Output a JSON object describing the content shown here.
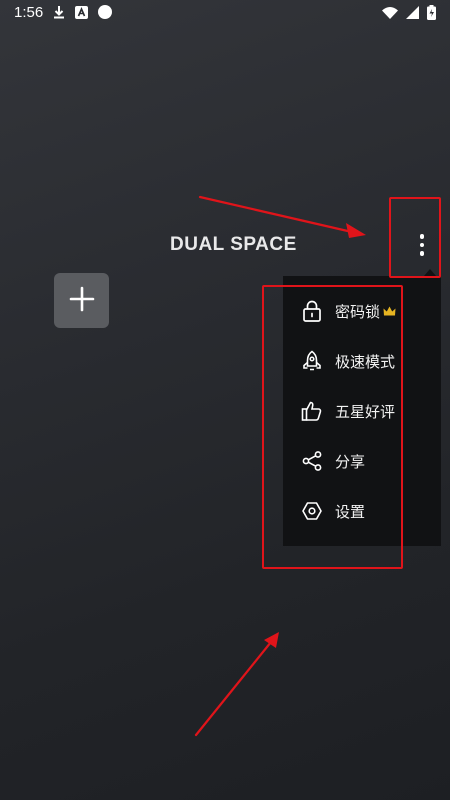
{
  "status_bar": {
    "time": "1:56",
    "icons": [
      "download-icon",
      "app-notification-icon",
      "circle-icon",
      "wifi-icon",
      "signal-icon",
      "battery-icon"
    ]
  },
  "logo": {
    "text": "DUAL SPACE"
  },
  "add_button": {
    "icon": "plus-icon"
  },
  "more_button": {
    "icon": "more-vertical-icon"
  },
  "menu": {
    "items": [
      {
        "label": "密码锁",
        "icon": "lock-icon",
        "badge": "crown-icon"
      },
      {
        "label": "极速模式",
        "icon": "rocket-icon"
      },
      {
        "label": "五星好评",
        "icon": "thumbs-up-icon"
      },
      {
        "label": "分享",
        "icon": "share-icon"
      },
      {
        "label": "设置",
        "icon": "settings-icon"
      }
    ]
  },
  "colors": {
    "background": "#2a2c31",
    "menu_background": "#111214",
    "add_button_background": "#5a5c60",
    "annotation_red": "#e0141a",
    "crown_gold": "#e6b422"
  }
}
